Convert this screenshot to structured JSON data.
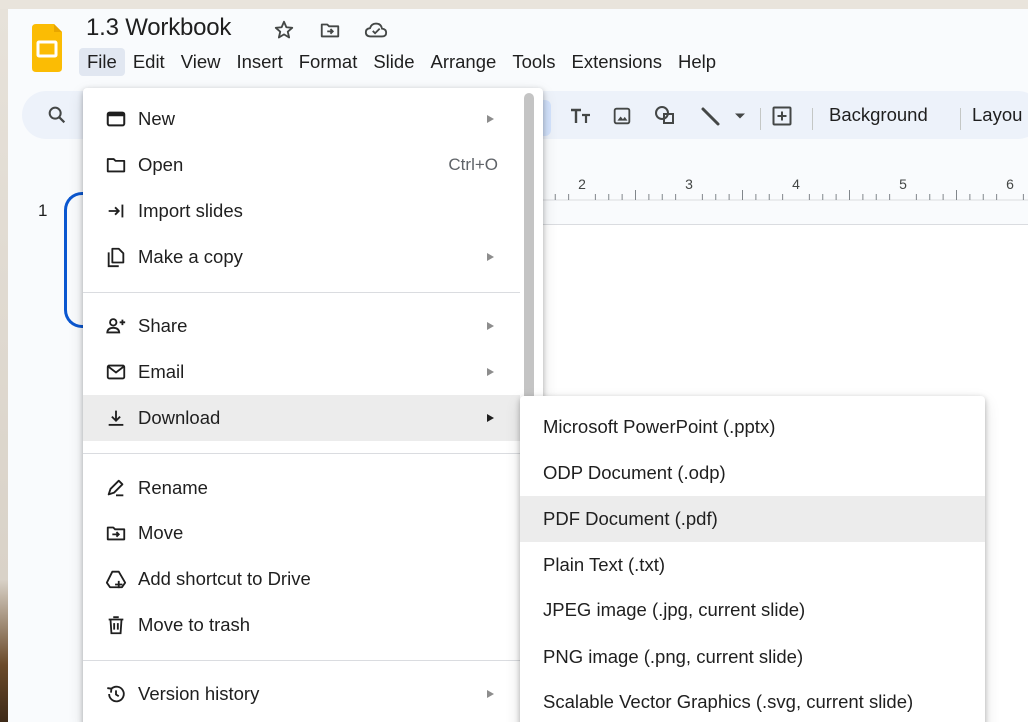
{
  "doc": {
    "title": "1.3 Workbook"
  },
  "menubar": [
    "File",
    "Edit",
    "View",
    "Insert",
    "Format",
    "Slide",
    "Arrange",
    "Tools",
    "Extensions",
    "Help"
  ],
  "toolbar": {
    "background_label": "Background",
    "layout_label": "Layou"
  },
  "ruler": {
    "marks": [
      "2",
      "3",
      "4",
      "5",
      "6"
    ]
  },
  "slide_panel": {
    "number": "1"
  },
  "file_menu": {
    "items": [
      {
        "label": "New",
        "icon": "new-icon",
        "submenu": true
      },
      {
        "label": "Open",
        "icon": "folder-icon",
        "shortcut": "Ctrl+O"
      },
      {
        "label": "Import slides",
        "icon": "import-icon"
      },
      {
        "label": "Make a copy",
        "icon": "copy-icon",
        "submenu": true
      },
      {
        "label": "Share",
        "icon": "share-person-icon",
        "submenu": true
      },
      {
        "label": "Email",
        "icon": "email-icon",
        "submenu": true
      },
      {
        "label": "Download",
        "icon": "download-icon",
        "submenu": true,
        "highlighted": true
      },
      {
        "label": "Rename",
        "icon": "rename-icon"
      },
      {
        "label": "Move",
        "icon": "move-folder-icon"
      },
      {
        "label": "Add shortcut to Drive",
        "icon": "drive-shortcut-icon"
      },
      {
        "label": "Move to trash",
        "icon": "trash-icon"
      },
      {
        "label": "Version history",
        "icon": "history-icon",
        "submenu": true
      }
    ]
  },
  "download_menu": {
    "items": [
      {
        "label": "Microsoft PowerPoint (.pptx)"
      },
      {
        "label": "ODP Document (.odp)"
      },
      {
        "label": "PDF Document (.pdf)",
        "highlighted": true
      },
      {
        "label": "Plain Text (.txt)"
      },
      {
        "label": "JPEG image (.jpg, current slide)"
      },
      {
        "label": "PNG image (.png, current slide)"
      },
      {
        "label": "Scalable Vector Graphics (.svg, current slide)"
      }
    ]
  },
  "colors": {
    "accent": "#0b57d0",
    "toolbar_bg": "#edf2fa",
    "logo": "#fbbc04",
    "hover": "#ececec"
  }
}
